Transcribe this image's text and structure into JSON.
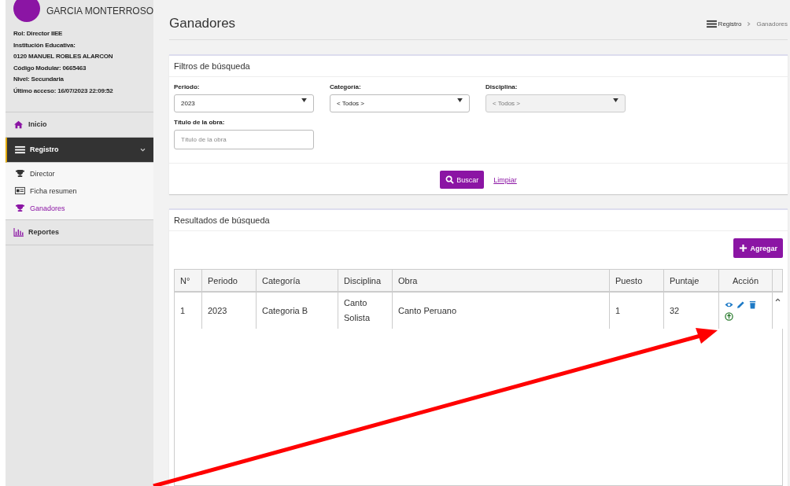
{
  "user": {
    "name": "GARCIA MONTERROSO",
    "info": [
      {
        "label": "Rol:",
        "value": "Director IIEE"
      },
      {
        "label": "Institución Educativa:"
      },
      {
        "label": "0120 MANUEL ROBLES ALARCON"
      },
      {
        "label": "Código Modular:",
        "value": "0665463"
      },
      {
        "label": "Nivel:",
        "value": "Secundaria"
      },
      {
        "label": "Último acceso:",
        "value": "16/07/2023 22:09:52"
      }
    ]
  },
  "sidebar": {
    "items": [
      {
        "label": "Inicio",
        "expanded": false
      },
      {
        "label": "Registro",
        "expanded": true,
        "children": [
          {
            "label": "Director",
            "selected": false
          },
          {
            "label": "Ficha resumen",
            "selected": false
          },
          {
            "label": "Ganadores",
            "selected": true
          }
        ]
      },
      {
        "label": "Reportes",
        "expanded": false
      }
    ]
  },
  "page": {
    "title": "Ganadores",
    "breadcrumb": [
      "Registro",
      "Ganadores"
    ]
  },
  "filters": {
    "title": "Filtros de búsqueda",
    "selects": [
      {
        "label": "Periodo:",
        "value": "2023",
        "disabled": false
      },
      {
        "label": "Categoría:",
        "value": "< Todos >",
        "disabled": false
      },
      {
        "label": "Disciplina:",
        "value": "< Todos >",
        "disabled": true
      }
    ],
    "title_field": {
      "label": "Título de la obra:",
      "placeholder": "Título de la obra"
    },
    "search_button": "Buscar",
    "clear_link": "Limpiar"
  },
  "results": {
    "title": "Resultados de búsqueda",
    "add_button": "Agregar",
    "table": {
      "columns": [
        "N°",
        "Periodo",
        "Categoría",
        "Disciplina",
        "Obra",
        "Puesto",
        "Puntaje",
        "Acción"
      ],
      "rows": [
        {
          "cells": [
            "1",
            "2023",
            "Categoria B",
            "Canto Solista",
            "Canto Peruano",
            "1",
            "32"
          ]
        }
      ]
    }
  }
}
